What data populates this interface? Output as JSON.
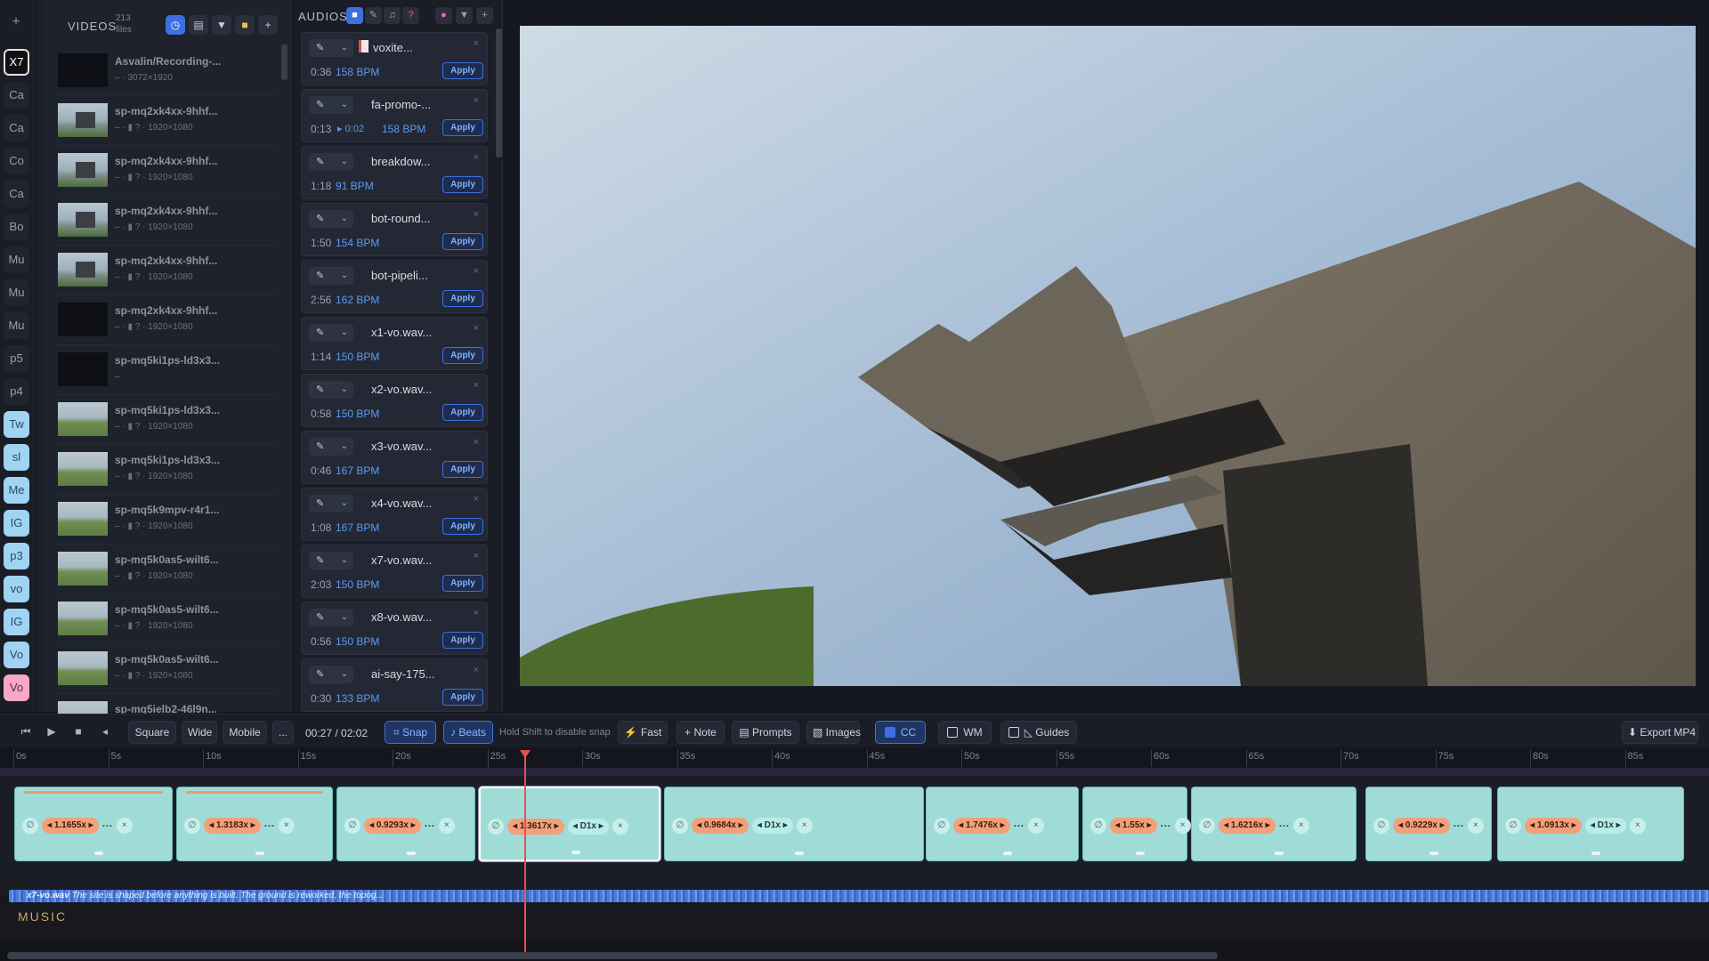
{
  "rail": {
    "add": "+",
    "items": [
      {
        "label": "X7",
        "style": "active"
      },
      {
        "label": "Ca",
        "style": ""
      },
      {
        "label": "Ca",
        "style": ""
      },
      {
        "label": "Co",
        "style": ""
      },
      {
        "label": "Ca",
        "style": ""
      },
      {
        "label": "Bo",
        "style": ""
      },
      {
        "label": "Mu",
        "style": ""
      },
      {
        "label": "Mu",
        "style": ""
      },
      {
        "label": "Mu",
        "style": ""
      },
      {
        "label": "p5",
        "style": ""
      },
      {
        "label": "p4",
        "style": ""
      },
      {
        "label": "Tw",
        "style": "blue"
      },
      {
        "label": "sl",
        "style": "blue"
      },
      {
        "label": "Me",
        "style": "blue"
      },
      {
        "label": "IG",
        "style": "blue"
      },
      {
        "label": "p3",
        "style": "blue"
      },
      {
        "label": "vo",
        "style": "blue"
      },
      {
        "label": "IG",
        "style": "blue"
      },
      {
        "label": "Vo",
        "style": "blue"
      },
      {
        "label": "Vo",
        "style": "pink"
      }
    ]
  },
  "videos": {
    "title": "VIDEOS",
    "count": "213 files",
    "items": [
      {
        "name": "Asvalin/Recording-...",
        "meta": "– · 3072×1920",
        "thumb": "dark"
      },
      {
        "name": "sp-mq2xk4xx-9hhf...",
        "meta": "– · ▮ ? · 1920×1080",
        "thumb": "sky"
      },
      {
        "name": "sp-mq2xk4xx-9hhf...",
        "meta": "– · ▮ ? · 1920×1080",
        "thumb": "sky"
      },
      {
        "name": "sp-mq2xk4xx-9hhf...",
        "meta": "– · ▮ ? · 1920×1080",
        "thumb": "sky"
      },
      {
        "name": "sp-mq2xk4xx-9hhf...",
        "meta": "– · ▮ ? · 1920×1080",
        "thumb": "sky"
      },
      {
        "name": "sp-mq2xk4xx-9hhf...",
        "meta": "– · ▮ ? · 1920×1080",
        "thumb": "dark"
      },
      {
        "name": "sp-mq5ki1ps-ld3x3...",
        "meta": "–",
        "thumb": "dark"
      },
      {
        "name": "sp-mq5ki1ps-ld3x3...",
        "meta": "– · ▮ ? · 1920×1080",
        "thumb": "grass"
      },
      {
        "name": "sp-mq5ki1ps-ld3x3...",
        "meta": "– · ▮ ? · 1920×1080",
        "thumb": "grass"
      },
      {
        "name": "sp-mq5k9mpv-r4r1...",
        "meta": "– · ▮ ? · 1920×1080",
        "thumb": "grass"
      },
      {
        "name": "sp-mq5k0as5-wilt6...",
        "meta": "– · ▮ ? · 1920×1080",
        "thumb": "grass"
      },
      {
        "name": "sp-mq5k0as5-wilt6...",
        "meta": "– · ▮ ? · 1920×1080",
        "thumb": "grass"
      },
      {
        "name": "sp-mq5k0as5-wilt6...",
        "meta": "– · ▮ ? · 1920×1080",
        "thumb": "grass"
      },
      {
        "name": "sp-mq5ielb2-46l9n...",
        "meta": "",
        "thumb": "grass"
      }
    ]
  },
  "audios": {
    "title": "AUDIOS",
    "apply_label": "Apply",
    "tool_icon": "✎",
    "items": [
      {
        "name": "voxite...",
        "duration": "0:36",
        "bpm": "158 BPM",
        "extra": "",
        "pdf": true
      },
      {
        "name": "fa-promo-...",
        "duration": "0:13",
        "bpm": "158 BPM",
        "extra": "▸ 0:02",
        "pdf": false
      },
      {
        "name": "breakdow...",
        "duration": "1:18",
        "bpm": "91 BPM",
        "extra": "",
        "pdf": false
      },
      {
        "name": "bot-round...",
        "duration": "1:50",
        "bpm": "154 BPM",
        "extra": "",
        "pdf": false
      },
      {
        "name": "bot-pipeli...",
        "duration": "2:56",
        "bpm": "162 BPM",
        "extra": "",
        "pdf": false
      },
      {
        "name": "x1-vo.wav...",
        "duration": "1:14",
        "bpm": "150 BPM",
        "extra": "",
        "pdf": false
      },
      {
        "name": "x2-vo.wav...",
        "duration": "0:58",
        "bpm": "150 BPM",
        "extra": "",
        "pdf": false
      },
      {
        "name": "x3-vo.wav...",
        "duration": "0:46",
        "bpm": "167 BPM",
        "extra": "",
        "pdf": false
      },
      {
        "name": "x4-vo.wav...",
        "duration": "1:08",
        "bpm": "167 BPM",
        "extra": "",
        "pdf": false
      },
      {
        "name": "x7-vo.wav...",
        "duration": "2:03",
        "bpm": "150 BPM",
        "extra": "",
        "pdf": false
      },
      {
        "name": "x8-vo.wav...",
        "duration": "0:56",
        "bpm": "150 BPM",
        "extra": "",
        "pdf": false
      },
      {
        "name": "ai-say-175...",
        "duration": "0:30",
        "bpm": "133 BPM",
        "extra": "",
        "pdf": false
      }
    ]
  },
  "toolbar": {
    "square": "Square",
    "wide": "Wide",
    "mobile": "Mobile",
    "more": "...",
    "timecode": "00:27 / 02:02",
    "snap": "Snap",
    "beats": "Beats",
    "hint": "Hold Shift to disable snap",
    "fast": "Fast",
    "note": "+ Note",
    "prompts": "Prompts",
    "images": "Images",
    "cc": "CC",
    "wm": "WM",
    "guides": "Guides",
    "export": "Export MP4"
  },
  "ruler": [
    "0s",
    "5s",
    "10s",
    "15s",
    "20s",
    "25s",
    "30s",
    "35s",
    "40s",
    "45s",
    "50s",
    "55s",
    "60s",
    "65s",
    "70s",
    "75s",
    "80s",
    "85s"
  ],
  "clips": [
    {
      "speed": "1.1655x",
      "d": ""
    },
    {
      "speed": "1.3183x",
      "d": ""
    },
    {
      "speed": "0.9293x",
      "d": ""
    },
    {
      "speed": "1.3617x",
      "d": "D1x"
    },
    {
      "speed": "0.9684x",
      "d": "D1x"
    },
    {
      "speed": "1.7476x",
      "d": ""
    },
    {
      "speed": "1.55x",
      "d": ""
    },
    {
      "speed": "1.6216x",
      "d": ""
    },
    {
      "speed": "0.9229x",
      "d": ""
    },
    {
      "speed": "1.0913x",
      "d": "D1x"
    }
  ],
  "audio_track": {
    "label": "x7-vo.wav",
    "transcript": "The site is shaped before anything is built. The ground is reworked, the topog..."
  },
  "music_label": "MUSIC",
  "colors": {
    "accent": "#3d6fe0",
    "clip": "#9fdcd8",
    "speed_pill": "#f2a07a",
    "playhead": "#e8504f"
  }
}
